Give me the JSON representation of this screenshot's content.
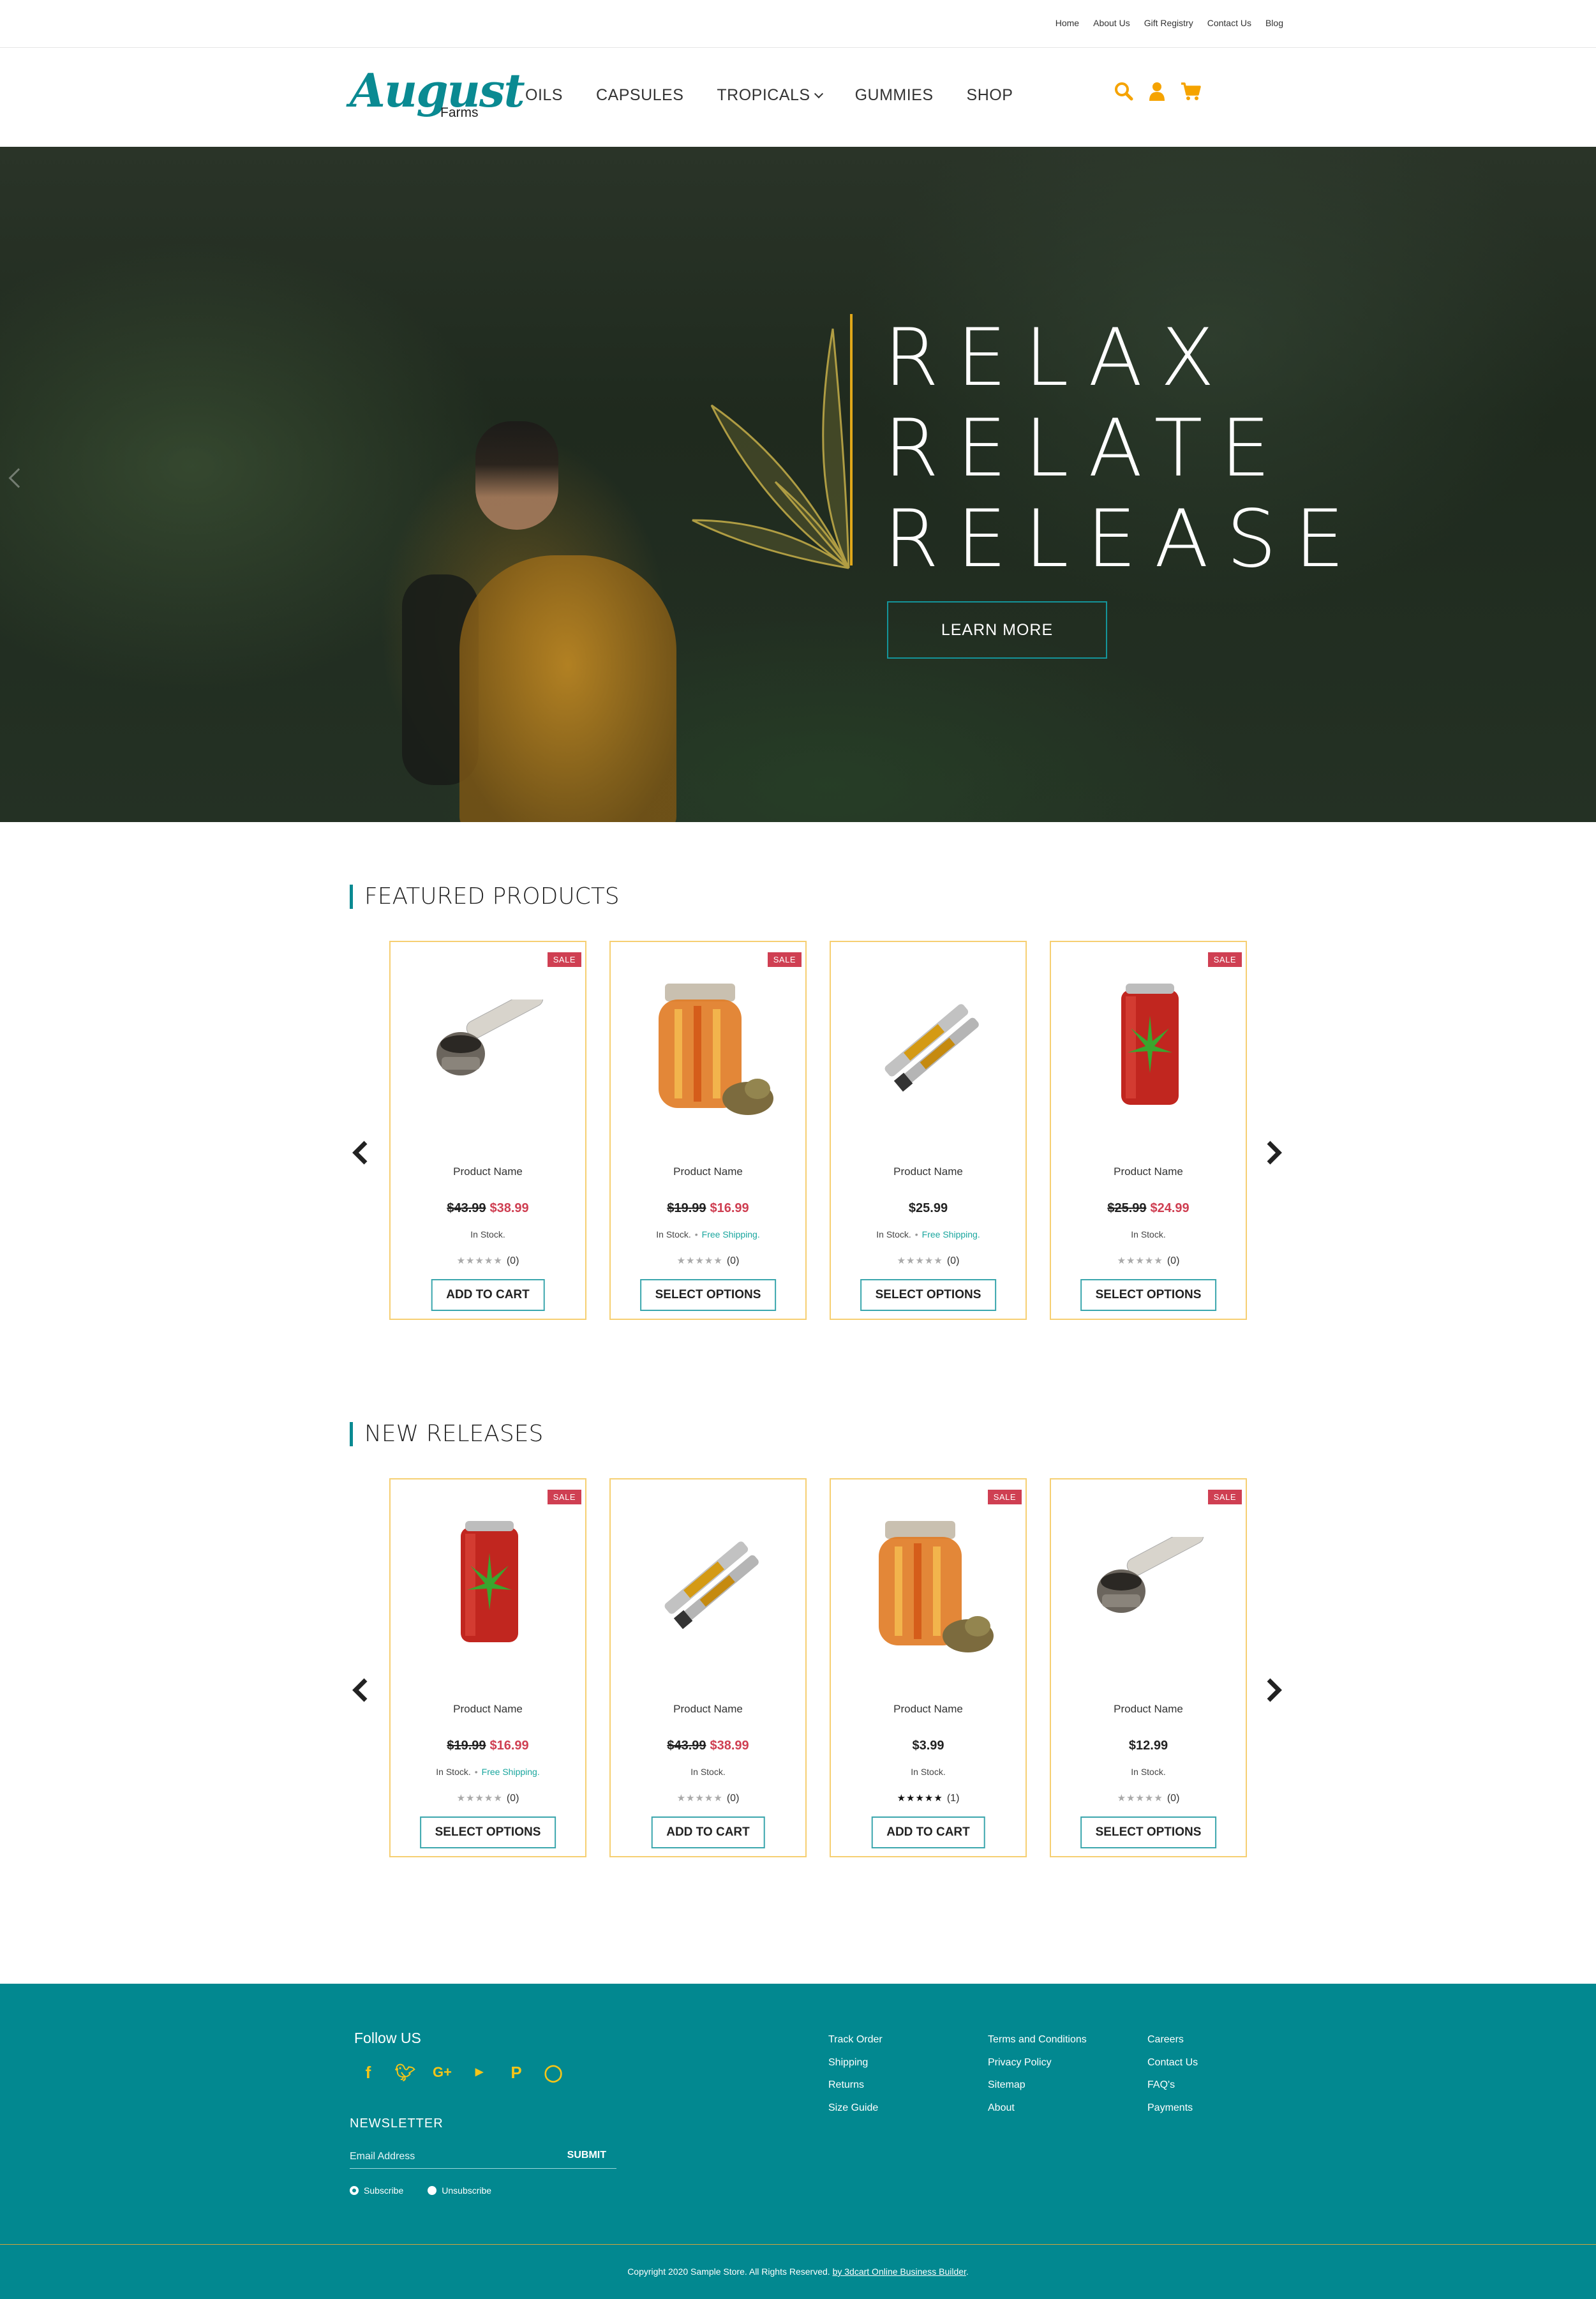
{
  "topbar": {
    "links": [
      "Home",
      "About Us",
      "Gift Registry",
      "Contact Us",
      "Blog"
    ]
  },
  "header": {
    "logo_script": "August",
    "logo_sub": "Farms",
    "nav": [
      "OILS",
      "CAPSULES",
      "TROPICALS",
      "GUMMIES",
      "SHOP"
    ],
    "icons": [
      "search-icon",
      "user-icon",
      "cart-icon"
    ],
    "accent_color": "#f5a300"
  },
  "hero": {
    "lines": [
      "RELAX",
      "RELATE",
      "RELEASE"
    ],
    "button": "LEARN MORE",
    "bar_color": "#e0a81a"
  },
  "featured": {
    "title": "FEATURED PRODUCTS",
    "products": [
      {
        "image": "pipe",
        "sale": "SALE",
        "name": "Product Name",
        "old_price": "$43.99",
        "new_price": "$38.99",
        "price": "",
        "stock": "In Stock.",
        "shipping": "",
        "stars": 0,
        "count": "(0)",
        "button": "ADD TO CART"
      },
      {
        "image": "jar",
        "sale": "SALE",
        "name": "Product Name",
        "old_price": "$19.99",
        "new_price": "$16.99",
        "price": "",
        "stock": "In Stock.",
        "shipping": "Free Shipping.",
        "stars": 0,
        "count": "(0)",
        "button": "SELECT OPTIONS"
      },
      {
        "image": "cartridge",
        "sale": "",
        "name": "Product Name",
        "old_price": "",
        "new_price": "",
        "price": "$25.99",
        "stock": "In Stock.",
        "shipping": "Free Shipping.",
        "stars": 0,
        "count": "(0)",
        "button": "SELECT OPTIONS"
      },
      {
        "image": "can",
        "sale": "SALE",
        "name": "Product Name",
        "old_price": "$25.99",
        "new_price": "$24.99",
        "price": "",
        "stock": "In Stock.",
        "shipping": "",
        "stars": 0,
        "count": "(0)",
        "button": "SELECT OPTIONS"
      }
    ]
  },
  "releases": {
    "title": "NEW RELEASES",
    "products": [
      {
        "image": "can",
        "sale": "SALE",
        "name": "Product Name",
        "old_price": "$19.99",
        "new_price": "$16.99",
        "price": "",
        "stock": "In Stock.",
        "shipping": "Free Shipping.",
        "stars": 0,
        "count": "(0)",
        "button": "SELECT OPTIONS"
      },
      {
        "image": "cartridge",
        "sale": "",
        "name": "Product Name",
        "old_price": "$43.99",
        "new_price": "$38.99",
        "price": "",
        "stock": "In Stock.",
        "shipping": "",
        "stars": 0,
        "count": "(0)",
        "button": "ADD TO CART"
      },
      {
        "image": "jar",
        "sale": "SALE",
        "name": "Product Name",
        "old_price": "",
        "new_price": "",
        "price": "$3.99",
        "stock": "In Stock.",
        "shipping": "",
        "stars": 5,
        "count": "(1)",
        "button": "ADD TO CART"
      },
      {
        "image": "pipe",
        "sale": "SALE",
        "name": "Product Name",
        "old_price": "",
        "new_price": "",
        "price": "$12.99",
        "stock": "In Stock.",
        "shipping": "",
        "stars": 0,
        "count": "(0)",
        "button": "SELECT OPTIONS"
      }
    ]
  },
  "footer": {
    "follow": "Follow US",
    "socials": [
      "facebook-icon",
      "twitter-icon",
      "google-plus-icon",
      "youtube-icon",
      "pinterest-icon",
      "instagram-icon"
    ],
    "newsletter_title": "NEWSLETTER",
    "email_placeholder": "Email Address",
    "submit": "SUBMIT",
    "subscribe": "Subscribe",
    "unsubscribe": "Unsubscribe",
    "col1": [
      "Track Order",
      "Shipping",
      "Returns",
      "Size Guide"
    ],
    "col2": [
      "Terms and Conditions",
      "Privacy Policy",
      "Sitemap",
      "About"
    ],
    "col3": [
      "Careers",
      "Contact Us",
      "FAQ's",
      "Payments"
    ],
    "copyright": "Copyright 2020 Sample Store. All Rights Reserved.",
    "builder_link": "by 3dcart Online Business Builder",
    "bg_color": "#028890"
  }
}
